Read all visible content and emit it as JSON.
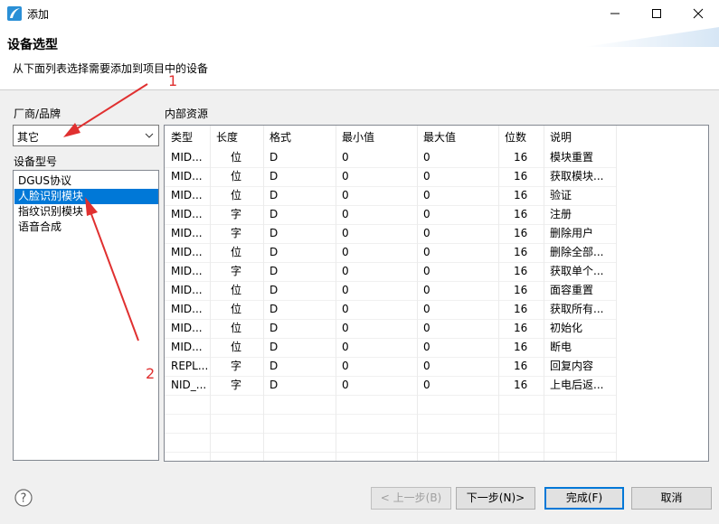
{
  "window": {
    "title": "添加"
  },
  "header": {
    "title": "设备选型",
    "description": "从下面列表选择需要添加到项目中的设备"
  },
  "brand": {
    "label": "厂商/品牌",
    "value": "其它"
  },
  "model": {
    "label": "设备型号",
    "items": [
      {
        "label": "DGUS协议"
      },
      {
        "label": "人脸识别模块",
        "selected": true
      },
      {
        "label": "指纹识别模块"
      },
      {
        "label": "语音合成"
      }
    ]
  },
  "resources": {
    "label": "内部资源",
    "columns": [
      "类型",
      "长度",
      "格式",
      "最小值",
      "最大值",
      "位数",
      "说明"
    ],
    "rows": [
      [
        "MID...",
        "位",
        "D",
        "0",
        "0",
        "16",
        "模块重置"
      ],
      [
        "MID...",
        "位",
        "D",
        "0",
        "0",
        "16",
        "获取模块..."
      ],
      [
        "MID...",
        "位",
        "D",
        "0",
        "0",
        "16",
        "验证"
      ],
      [
        "MID...",
        "字",
        "D",
        "0",
        "0",
        "16",
        "注册"
      ],
      [
        "MID...",
        "字",
        "D",
        "0",
        "0",
        "16",
        "删除用户"
      ],
      [
        "MID...",
        "位",
        "D",
        "0",
        "0",
        "16",
        "删除全部..."
      ],
      [
        "MID...",
        "字",
        "D",
        "0",
        "0",
        "16",
        "获取单个..."
      ],
      [
        "MID...",
        "位",
        "D",
        "0",
        "0",
        "16",
        "面容重置"
      ],
      [
        "MID...",
        "位",
        "D",
        "0",
        "0",
        "16",
        "获取所有..."
      ],
      [
        "MID...",
        "位",
        "D",
        "0",
        "0",
        "16",
        "初始化"
      ],
      [
        "MID...",
        "位",
        "D",
        "0",
        "0",
        "16",
        "断电"
      ],
      [
        "REPL...",
        "字",
        "D",
        "0",
        "0",
        "16",
        "回复内容"
      ],
      [
        "NID_...",
        "字",
        "D",
        "0",
        "0",
        "16",
        "上电后返..."
      ]
    ]
  },
  "buttons": {
    "back": "< 上一步(B)",
    "next": "下一步(N)>",
    "finish": "完成(F)",
    "cancel": "取消"
  },
  "annotations": {
    "one": "1",
    "two": "2"
  },
  "colors": {
    "selection": "#0078d7",
    "annotation": "#e03030"
  }
}
